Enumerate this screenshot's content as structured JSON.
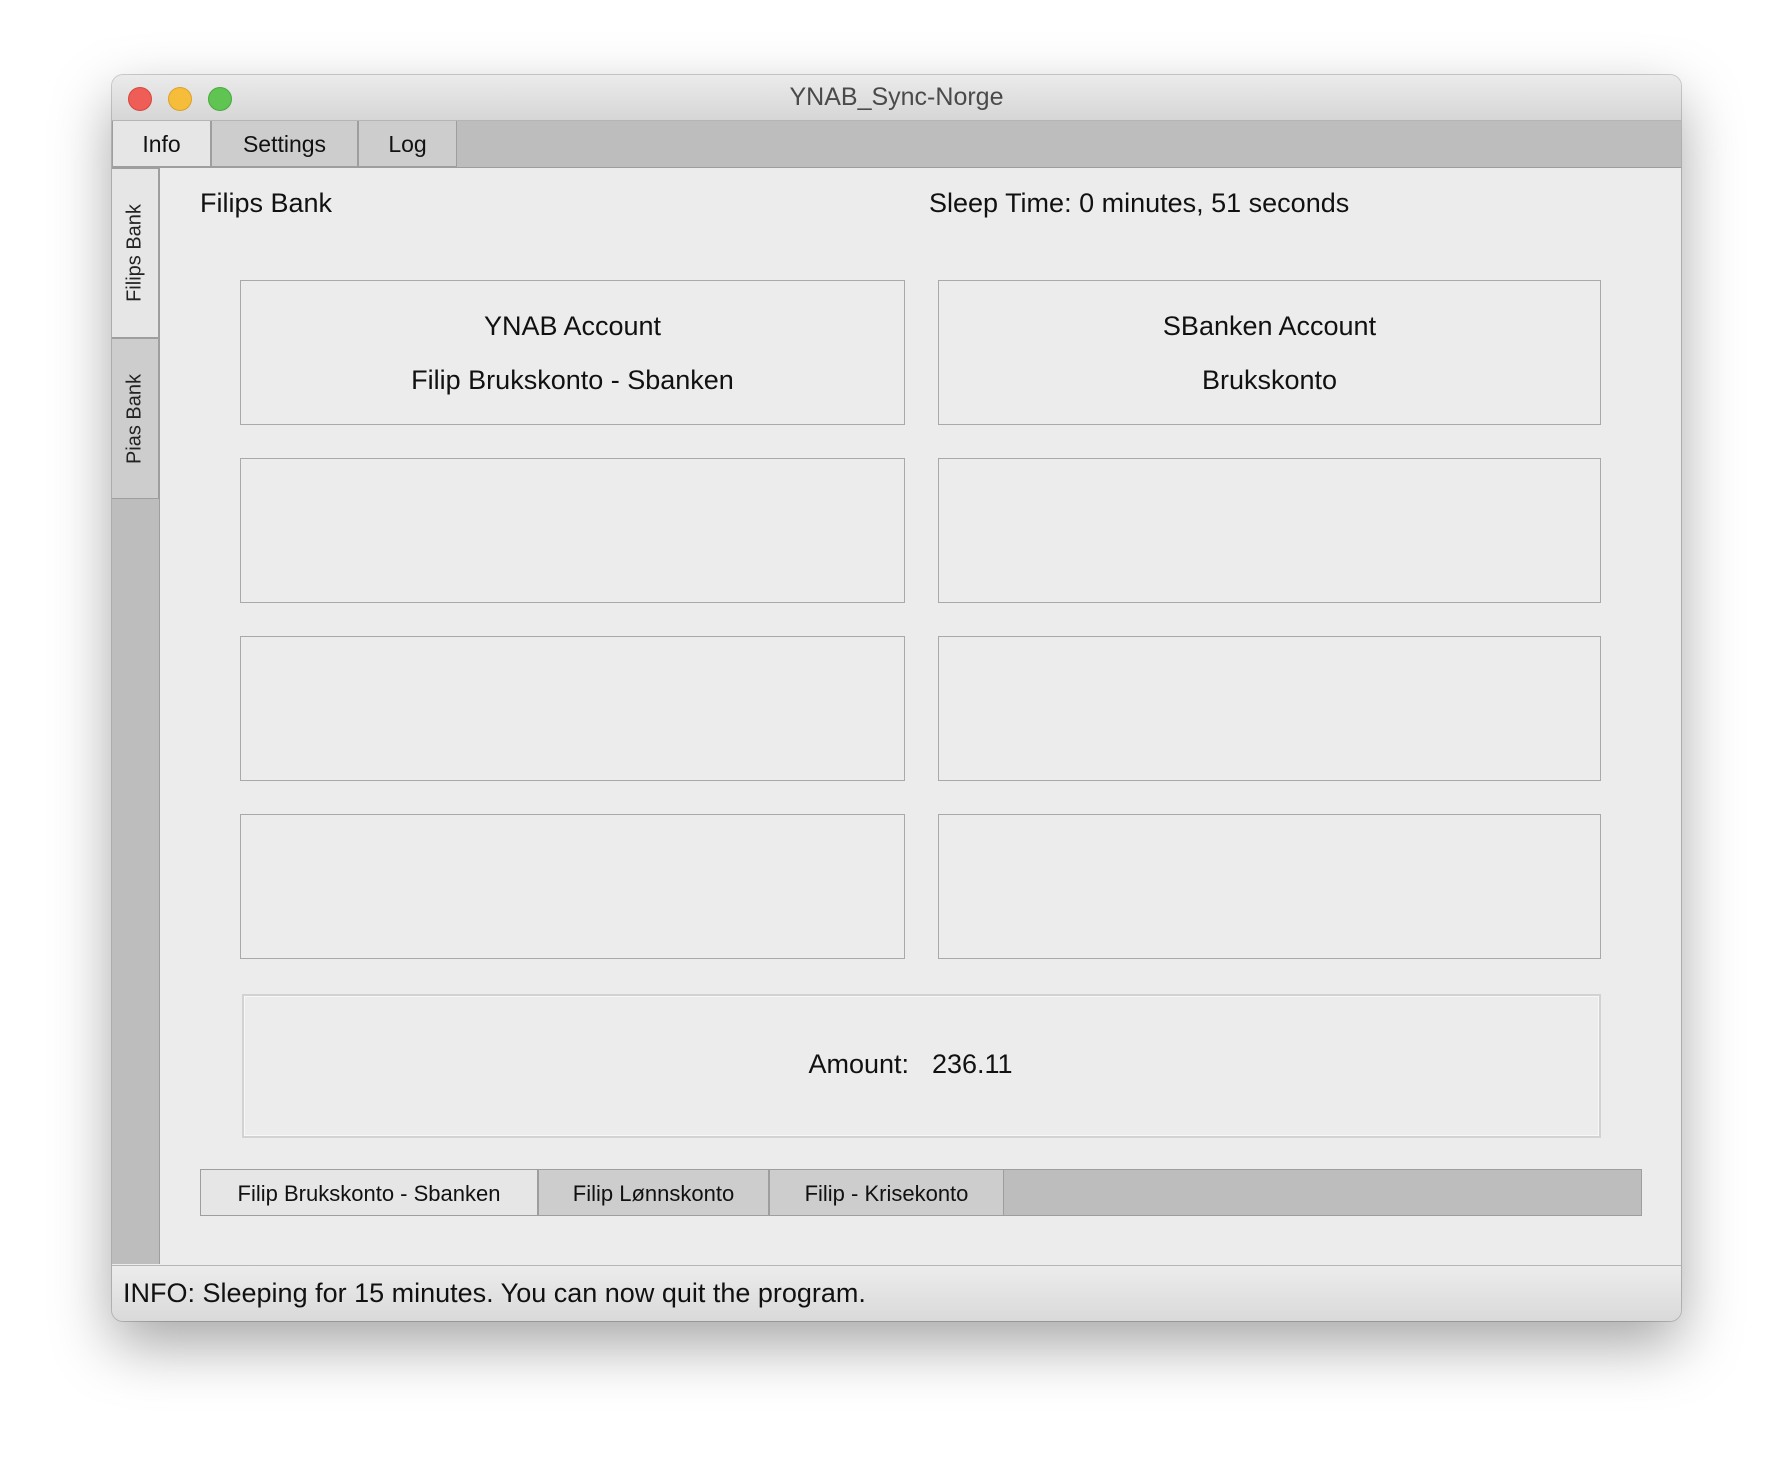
{
  "window": {
    "title": "YNAB_Sync-Norge"
  },
  "main_tabs": [
    "Info",
    "Settings",
    "Log"
  ],
  "side_tabs": [
    "Filips Bank",
    "Pias Bank"
  ],
  "content": {
    "bank_title": "Filips Bank",
    "sleep_time": "Sleep Time: 0 minutes, 51 seconds",
    "ynab_box": {
      "title": "YNAB Account",
      "value": "Filip Brukskonto - Sbanken"
    },
    "sbanken_box": {
      "title": "SBanken Account",
      "value": "Brukskonto"
    },
    "amount": {
      "label": "Amount:",
      "value": "236.11"
    }
  },
  "account_tabs": [
    "Filip Brukskonto - Sbanken",
    "Filip Lønnskonto",
    "Filip - Krisekonto"
  ],
  "status": {
    "text": "INFO: Sleeping for 15 minutes. You can now quit the program."
  }
}
